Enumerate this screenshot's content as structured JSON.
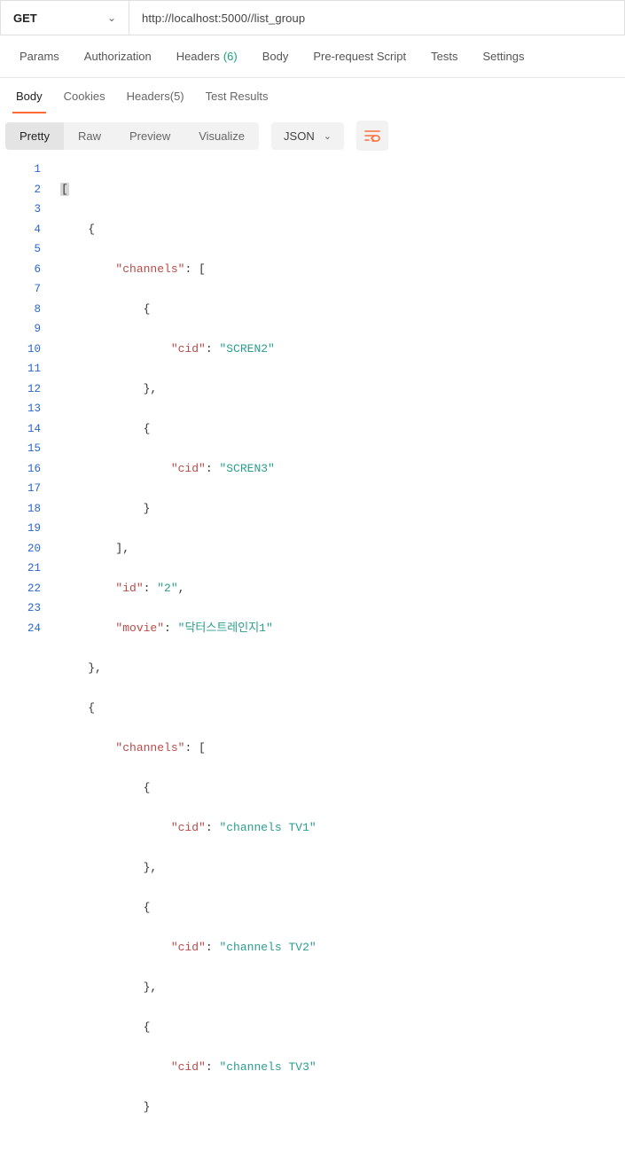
{
  "request": {
    "method": "GET",
    "url": "http://localhost:5000//list_group"
  },
  "reqTabs": {
    "params": "Params",
    "auth": "Authorization",
    "headers": "Headers",
    "headersCount": "(6)",
    "body": "Body",
    "prereq": "Pre-request Script",
    "tests": "Tests",
    "settings": "Settings"
  },
  "respTabs": {
    "body": "Body",
    "cookies": "Cookies",
    "headers": "Headers",
    "headersCount": "(5)",
    "results": "Test Results"
  },
  "viewSeg": {
    "pretty": "Pretty",
    "raw": "Raw",
    "preview": "Preview",
    "visualize": "Visualize"
  },
  "format": "JSON",
  "code": {
    "l1": "[",
    "l2_brace": "{",
    "l3_key": "\"channels\"",
    "l3_colon": ": [",
    "l4_brace": "{",
    "l5_key": "\"cid\"",
    "l5_val": "\"SCREN2\"",
    "l6_brace": "},",
    "l7_brace": "{",
    "l8_key": "\"cid\"",
    "l8_val": "\"SCREN3\"",
    "l9_brace": "}",
    "l10_brace": "],",
    "l11_key": "\"id\"",
    "l11_val": "\"2\"",
    "l11_comma": ",",
    "l12_key": "\"movie\"",
    "l12_val": "\"닥터스트레인지1\"",
    "l13_brace": "},",
    "l14_brace": "{",
    "l15_key": "\"channels\"",
    "l15_colon": ": [",
    "l16_brace": "{",
    "l17_key": "\"cid\"",
    "l17_val": "\"channels TV1\"",
    "l18_brace": "},",
    "l19_brace": "{",
    "l20_key": "\"cid\"",
    "l20_val": "\"channels TV2\"",
    "l21_brace": "},",
    "l22_brace": "{",
    "l23_key": "\"cid\"",
    "l23_val": "\"channels TV3\"",
    "l24_brace": "}"
  },
  "lineNums": [
    "1",
    "2",
    "3",
    "4",
    "5",
    "6",
    "7",
    "8",
    "9",
    "10",
    "11",
    "12",
    "13",
    "14",
    "15",
    "16",
    "17",
    "18",
    "19",
    "20",
    "21",
    "22",
    "23",
    "24"
  ]
}
